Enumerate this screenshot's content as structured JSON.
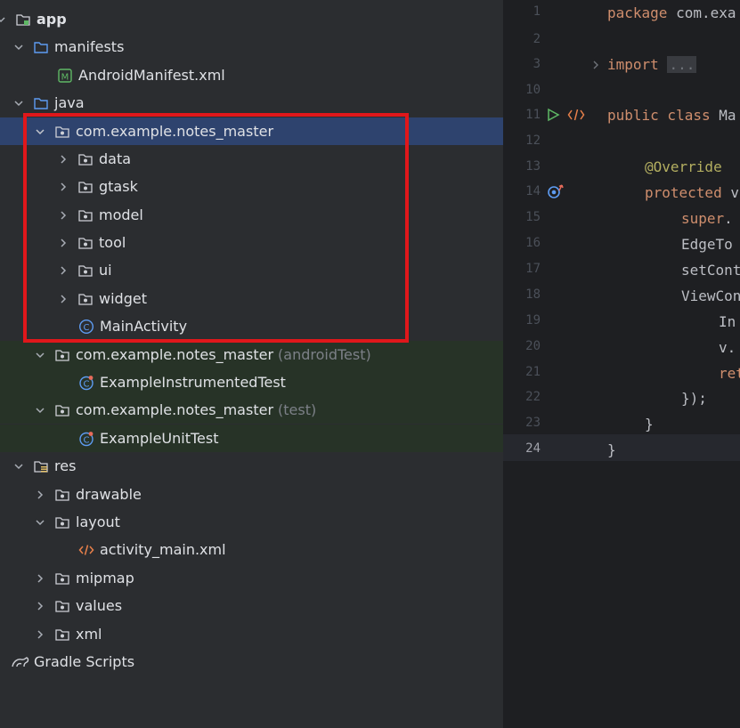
{
  "tree": {
    "rows": [
      {
        "label": "app",
        "suffix": ""
      },
      {
        "label": "manifests",
        "suffix": ""
      },
      {
        "label": "AndroidManifest.xml",
        "suffix": ""
      },
      {
        "label": "java",
        "suffix": ""
      },
      {
        "label": "com.example.notes_master",
        "suffix": ""
      },
      {
        "label": "data",
        "suffix": ""
      },
      {
        "label": "gtask",
        "suffix": ""
      },
      {
        "label": "model",
        "suffix": ""
      },
      {
        "label": "tool",
        "suffix": ""
      },
      {
        "label": "ui",
        "suffix": ""
      },
      {
        "label": "widget",
        "suffix": ""
      },
      {
        "label": "MainActivity",
        "suffix": ""
      },
      {
        "label": "com.example.notes_master",
        "suffix": "(androidTest)"
      },
      {
        "label": "ExampleInstrumentedTest",
        "suffix": ""
      },
      {
        "label": "com.example.notes_master",
        "suffix": "(test)"
      },
      {
        "label": "ExampleUnitTest",
        "suffix": ""
      },
      {
        "label": "res",
        "suffix": ""
      },
      {
        "label": "drawable",
        "suffix": ""
      },
      {
        "label": "layout",
        "suffix": ""
      },
      {
        "label": "activity_main.xml",
        "suffix": ""
      },
      {
        "label": "mipmap",
        "suffix": ""
      },
      {
        "label": "values",
        "suffix": ""
      },
      {
        "label": "xml",
        "suffix": ""
      },
      {
        "label": "Gradle Scripts",
        "suffix": ""
      }
    ]
  },
  "editor": {
    "line_numbers": [
      "1",
      "2",
      "3",
      "10",
      "11",
      "12",
      "13",
      "14",
      "15",
      "16",
      "17",
      "18",
      "19",
      "20",
      "21",
      "22",
      "23",
      "24"
    ],
    "current_line": "24",
    "code": {
      "l1_kw": "package",
      "l1_rest": " com.exa",
      "l3_kw": "import",
      "l3_fold": "...",
      "l11_kw": "public class",
      "l11_rest": " Ma",
      "l13_ann": "@Override",
      "l14_kw": "protected",
      "l14_rest": " v",
      "l15_kw": "super",
      "l15_rest": ".",
      "l16": "EdgeTo",
      "l17": "setCont",
      "l18": "ViewCon",
      "l19": "In",
      "l20": "v.",
      "l21_kw": "ret",
      "l22": "});",
      "l23": "}",
      "l24": "}"
    }
  },
  "colors": {
    "selection": "#2e436e",
    "test_source_bg": "#273327",
    "highlight_box": "#e0171b"
  }
}
